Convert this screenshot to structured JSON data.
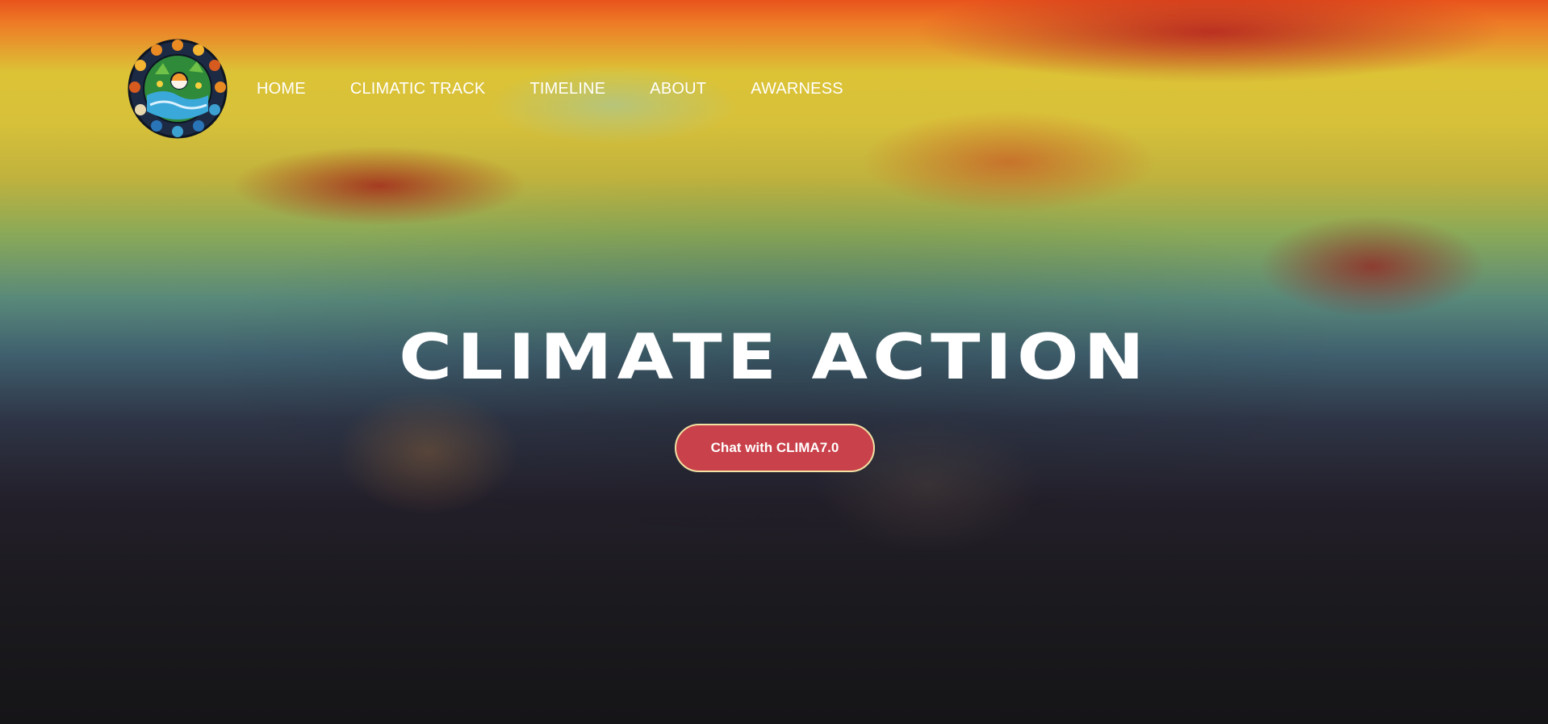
{
  "nav": {
    "items": [
      {
        "label": "HOME"
      },
      {
        "label": "CLIMATIC TRACK"
      },
      {
        "label": "TIMELINE"
      },
      {
        "label": "ABOUT"
      },
      {
        "label": "AWARNESS"
      }
    ]
  },
  "hero": {
    "title": "CLIMATE ACTION",
    "cta_label": "Chat with CLIMA7.0"
  },
  "colors": {
    "cta_background": "#c9414a",
    "cta_border": "#f1e1a3",
    "text": "#ffffff"
  },
  "icons": {
    "logo": "climate-emblem-logo"
  }
}
